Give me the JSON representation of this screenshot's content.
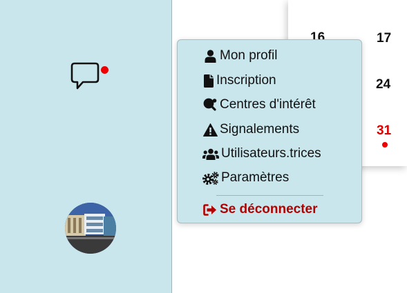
{
  "sidebar": {
    "chat_icon": "chat-bubble-icon",
    "notification_color": "#ee0000",
    "avatar": "profile-photo-building"
  },
  "calendar": {
    "days": [
      {
        "label": "16",
        "highlight": false,
        "event": false
      },
      {
        "label": "17",
        "highlight": false,
        "event": false
      },
      {
        "label": "24",
        "highlight": false,
        "event": false
      },
      {
        "label": "31",
        "highlight": true,
        "event": true
      }
    ]
  },
  "menu": {
    "items": [
      {
        "label": "Mon profil",
        "icon": "user-icon"
      },
      {
        "label": "Inscription",
        "icon": "file-icon"
      },
      {
        "label": "Centres d'intérêt",
        "icon": "table-tennis-icon"
      },
      {
        "label": "Signalements",
        "icon": "warning-icon"
      },
      {
        "label": "Utilisateurs.trices",
        "icon": "users-icon"
      },
      {
        "label": "Paramètres",
        "icon": "gears-icon"
      }
    ],
    "logout": {
      "label": "Se déconnecter",
      "icon": "sign-out-icon"
    }
  },
  "colors": {
    "sidebar_bg": "#c9e6ec",
    "logout": "#b30000",
    "weekend_day": "#dd0000"
  }
}
